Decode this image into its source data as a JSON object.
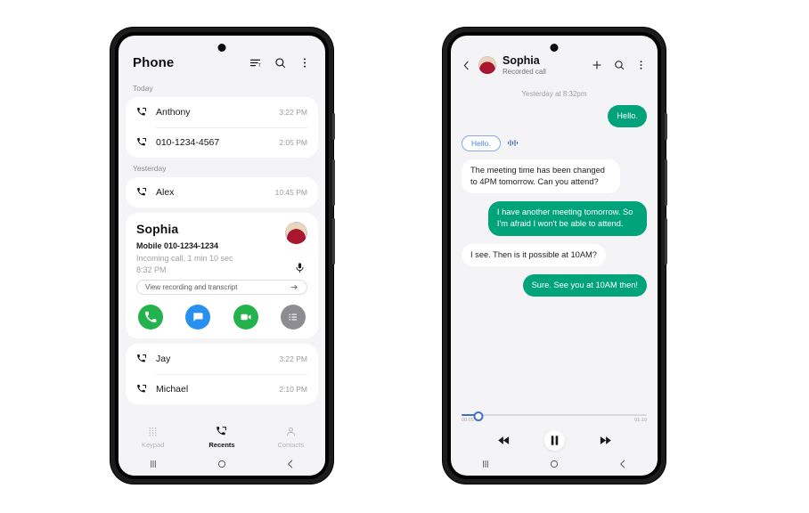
{
  "phone1": {
    "header": {
      "title": "Phone",
      "icons": [
        "sort-icon",
        "search-icon",
        "more-options-icon"
      ]
    },
    "sections": [
      {
        "label": "Today",
        "calls": [
          {
            "name": "Anthony",
            "time": "3:22 PM",
            "icon": "outgoing-call-icon"
          },
          {
            "name": "010-1234-4567",
            "time": "2:05 PM",
            "icon": "outgoing-call-icon"
          }
        ]
      },
      {
        "label": "Yesterday",
        "calls": [
          {
            "name": "Alex",
            "time": "10:45 PM",
            "icon": "outgoing-call-icon"
          }
        ]
      }
    ],
    "expanded_call": {
      "name": "Sophia",
      "number_label": "Mobile 010-1234-1234",
      "detail": "Incoming call, 1 min 10 sec",
      "time": "8:32 PM",
      "transcript_label": "View recording and transcript",
      "transcript_arrow": "arrow-right-icon",
      "mic_icon": "microphone-icon",
      "avatar": "contact-photo-sophia",
      "actions": [
        {
          "name": "call-action",
          "icon": "phone-icon",
          "color": "#24b24c"
        },
        {
          "name": "message-action",
          "icon": "chat-bubble-icon",
          "color": "#2a90f0"
        },
        {
          "name": "video-call-action",
          "icon": "video-camera-icon",
          "color": "#24b24c"
        },
        {
          "name": "details-action",
          "icon": "list-icon",
          "color": "#8c8c92"
        }
      ]
    },
    "after_calls": [
      {
        "name": "Jay",
        "time": "3:22 PM",
        "icon": "outgoing-call-icon"
      },
      {
        "name": "Michael",
        "time": "2:10 PM",
        "icon": "outgoing-call-icon"
      }
    ],
    "tabs": [
      {
        "label": "Keypad",
        "icon": "keypad-icon",
        "active": false
      },
      {
        "label": "Recents",
        "icon": "recent-calls-icon",
        "active": true
      },
      {
        "label": "Contacts",
        "icon": "person-icon",
        "active": false
      }
    ],
    "navbar": [
      "recents-nav-icon",
      "home-nav-icon",
      "back-nav-icon"
    ]
  },
  "phone2": {
    "header": {
      "back_icon": "chevron-left-icon",
      "avatar": "contact-photo-sophia",
      "name": "Sophia",
      "subtitle": "Recorded call",
      "icons": [
        "add-icon",
        "search-icon",
        "more-options-icon"
      ]
    },
    "datestamp": "Yesterday at 8:32pm",
    "messages": [
      {
        "side": "right",
        "kind": "bubble",
        "text": "Hello."
      },
      {
        "side": "left",
        "kind": "pill",
        "text": "Hello.",
        "trailing_icon": "audio-waveform-icon"
      },
      {
        "side": "left",
        "kind": "bubble",
        "text": "The meeting time has been changed to 4PM tomorrow. Can you attend?"
      },
      {
        "side": "right",
        "kind": "bubble",
        "text": "I have another meeting tomorrow. So I'm afraid I won't be able to attend."
      },
      {
        "side": "left",
        "kind": "bubble",
        "text": "I see. Then is it possible at 10AM?"
      },
      {
        "side": "right",
        "kind": "bubble",
        "text": "Sure. See you at 10AM then!"
      }
    ],
    "player": {
      "elapsed": "00:05",
      "duration": "01:10",
      "progress_percent": 9,
      "controls": [
        {
          "name": "rewind-button",
          "icon": "rewind-icon"
        },
        {
          "name": "pause-button",
          "icon": "pause-icon"
        },
        {
          "name": "fast-forward-button",
          "icon": "fast-forward-icon"
        }
      ]
    },
    "navbar": [
      "recents-nav-icon",
      "home-nav-icon",
      "back-nav-icon"
    ]
  },
  "colors": {
    "accent_green": "#00a37a",
    "screen_bg": "#f4f4f6",
    "bubble_in": "#ffffff",
    "pill_blue": "#4f7fd6",
    "slider_blue": "#3f6ecb"
  }
}
